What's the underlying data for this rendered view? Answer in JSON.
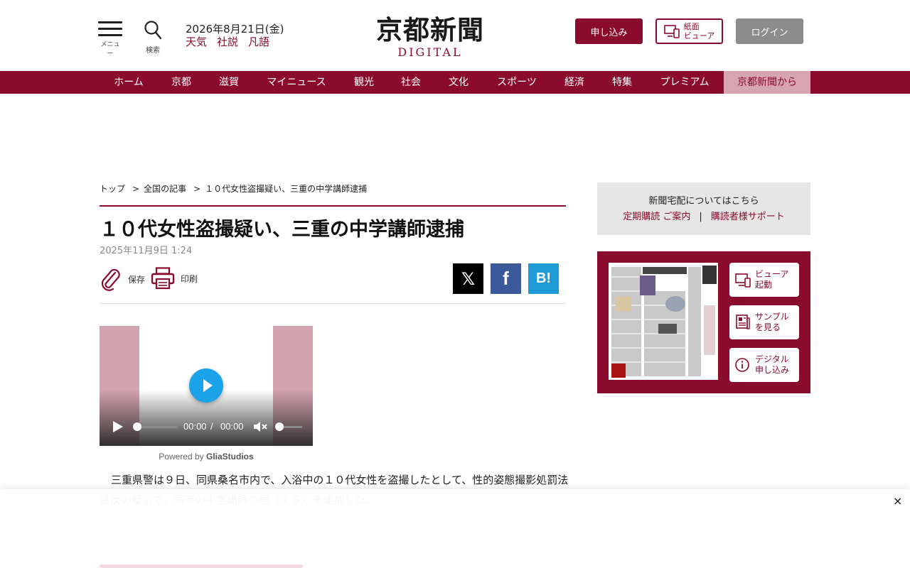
{
  "header": {
    "menu_label": "メニュー",
    "search_label": "検索",
    "date": "2026年8月21日(金)",
    "quick_links": [
      "天気",
      "社説",
      "凡語"
    ],
    "logo_main": "京都新聞",
    "logo_sub": "DIGITAL",
    "subscribe_label": "申し込み",
    "viewer_label_1": "紙面",
    "viewer_label_2": "ビューア",
    "login_label": "ログイン"
  },
  "nav": {
    "items": [
      "ホーム",
      "京都",
      "滋賀",
      "マイニュース",
      "観光",
      "社会",
      "文化",
      "スポーツ",
      "経済",
      "特集",
      "プレミアム",
      "京都新聞から"
    ]
  },
  "breadcrumb": [
    "トップ",
    "全国の記事",
    "１０代女性盗撮疑い、三重の中学講師逮捕"
  ],
  "article": {
    "title": "１０代女性盗撮疑い、三重の中学講師逮捕",
    "date": "2025年11月9日 1:24",
    "save_label": "保存",
    "print_label": "印刷",
    "share_x": "𝕏",
    "share_fb": "f",
    "share_hb": "B!",
    "body": "三重県警は９日、同県桑名市内で、入浴中の１０代女性を盗撮したとして、性的姿態撮影処罰法違反の疑いで、同市の中学講師の男（２５）を逮捕した。"
  },
  "video": {
    "current_time": "00:00",
    "time_sep": "/",
    "duration": "00:00",
    "progress": 0,
    "volume": 0,
    "powered_prefix": "Powered by ",
    "powered_brand": "GliaStudios"
  },
  "sidebar": {
    "delivery_title": "新聞宅配についてはこちら",
    "delivery_link_1": "定期購読 ご案内",
    "delivery_sep": "|",
    "delivery_link_2": "購読者様サポート",
    "paper_buttons": [
      {
        "line1": "ビューア",
        "line2": "起動",
        "icon": "devices-icon"
      },
      {
        "line1": "サンプル",
        "line2": "を見る",
        "icon": "newspaper-icon"
      },
      {
        "line1": "デジタル",
        "line2": "申し込み",
        "icon": "info-icon"
      }
    ]
  },
  "overlay": {
    "close": "×"
  },
  "colors": {
    "brand": "#8a0b2b",
    "nav_active_bg": "#d6a5b1",
    "video_side": "#d4a3b0",
    "play_blue": "#1aa3e8",
    "x_black": "#000000",
    "facebook": "#3b5998",
    "hatena": "#1d9bd7"
  }
}
